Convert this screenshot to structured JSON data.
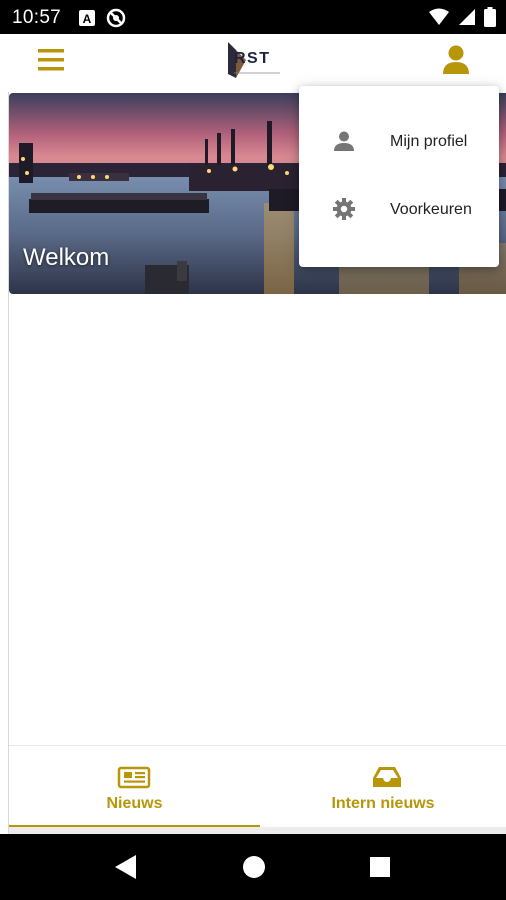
{
  "status_bar": {
    "time": "10:57",
    "left_icons": [
      "a-notification-icon",
      "dnd-icon"
    ],
    "right_icons": [
      "wifi-icon",
      "signal-icon",
      "battery-icon"
    ]
  },
  "app_bar": {
    "logo_text": "RST",
    "menu_icon": "hamburger-menu-icon",
    "user_icon": "user-icon",
    "accent_color": "#b8960a"
  },
  "hero": {
    "title": "Welkom"
  },
  "dropdown": {
    "items": [
      {
        "label": "Mijn profiel",
        "icon": "person-icon"
      },
      {
        "label": "Voorkeuren",
        "icon": "gear-icon"
      }
    ]
  },
  "bottom_nav": {
    "tabs": [
      {
        "label": "Nieuws",
        "icon": "newspaper-icon",
        "active": true
      },
      {
        "label": "Intern nieuws",
        "icon": "inbox-icon",
        "active": false
      }
    ]
  },
  "system_nav": {
    "buttons": [
      "back-icon",
      "home-icon",
      "recents-icon"
    ]
  }
}
